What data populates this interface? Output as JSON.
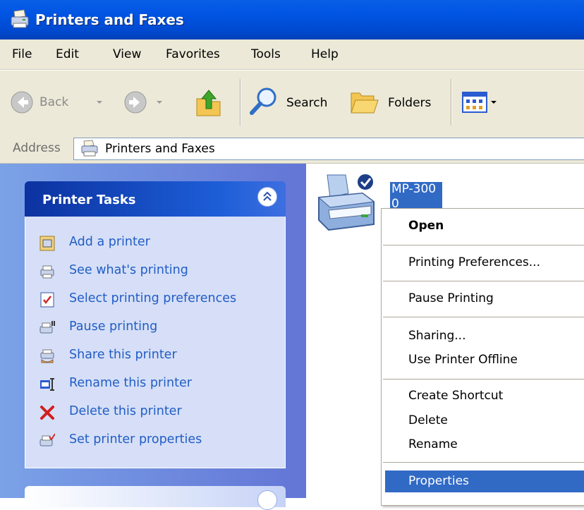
{
  "window": {
    "title": "Printers and Faxes"
  },
  "menu": {
    "items": [
      "File",
      "Edit",
      "View",
      "Favorites",
      "Tools",
      "Help"
    ]
  },
  "toolbar": {
    "back_label": "Back",
    "search_label": "Search",
    "folders_label": "Folders"
  },
  "address": {
    "label": "Address",
    "value": "Printers and Faxes"
  },
  "tasks": {
    "title": "Printer Tasks",
    "items": [
      {
        "label": "Add a printer",
        "icon": "add-printer-icon"
      },
      {
        "label": "See what's printing",
        "icon": "printer-queue-icon"
      },
      {
        "label": "Select printing preferences",
        "icon": "preferences-checkbox-icon"
      },
      {
        "label": "Pause printing",
        "icon": "pause-printer-icon"
      },
      {
        "label": "Share this printer",
        "icon": "share-printer-icon"
      },
      {
        "label": "Rename this printer",
        "icon": "rename-icon"
      },
      {
        "label": "Delete this printer",
        "icon": "delete-x-icon"
      },
      {
        "label": "Set printer properties",
        "icon": "printer-properties-icon"
      }
    ]
  },
  "printer": {
    "name_line1": "MP-300",
    "name_line2": "0"
  },
  "context_menu": {
    "items": [
      {
        "label": "Open",
        "bold": true
      },
      {
        "label": "Printing Preferences..."
      },
      {
        "label": "Pause Printing"
      },
      {
        "label": "Sharing..."
      },
      {
        "label": "Use Printer Offline"
      },
      {
        "label": "Create Shortcut"
      },
      {
        "label": "Delete"
      },
      {
        "label": "Rename"
      },
      {
        "label": "Properties",
        "highlighted": true
      }
    ]
  },
  "colors": {
    "titlebar": "#0054e3",
    "selection": "#316ac5",
    "task_link": "#215dc6",
    "taskpane_bg": "#d6dff7",
    "menubar": "#ece9d8"
  }
}
